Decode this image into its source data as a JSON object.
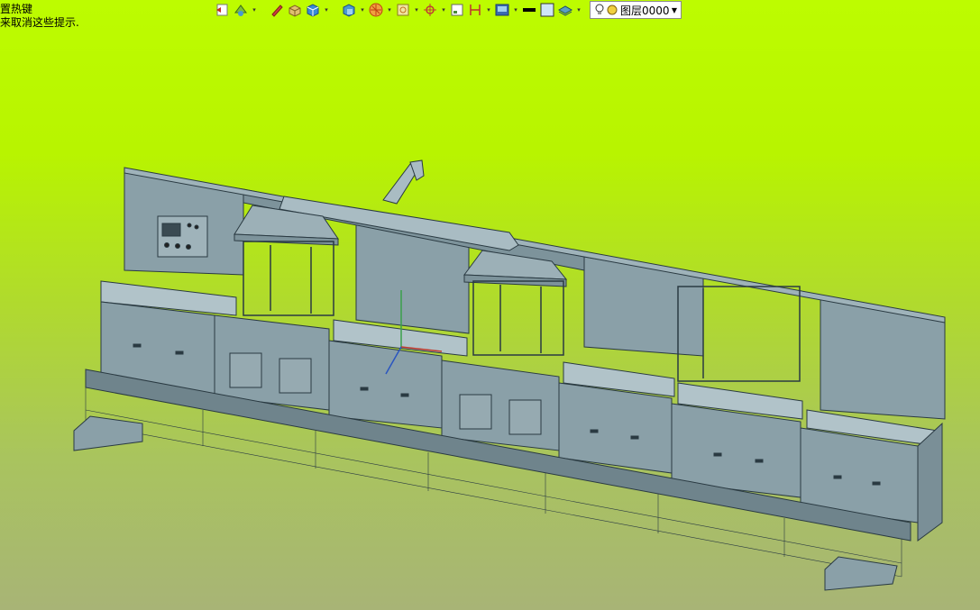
{
  "hint": {
    "line1": "置热键",
    "line2": "来取消这些提示."
  },
  "toolbar": {
    "icons": [
      "previous-view-icon",
      "display-style-icon",
      "pencil-icon",
      "box-icon",
      "cube-icon",
      "view-orientation-icon",
      "section-view-icon",
      "zoom-area-icon",
      "center-icon",
      "sketch-icon",
      "dimension-icon",
      "appearance-icon",
      "line-color-icon",
      "face-color-icon",
      "layer-tool-icon",
      "lightbulb-icon"
    ],
    "layer_label": "图层0000"
  },
  "colors": {
    "background_top": "#bdfc00",
    "background_bottom": "#a8b476",
    "model_face": "#8aa0a8",
    "model_edge": "#2a3a42"
  }
}
